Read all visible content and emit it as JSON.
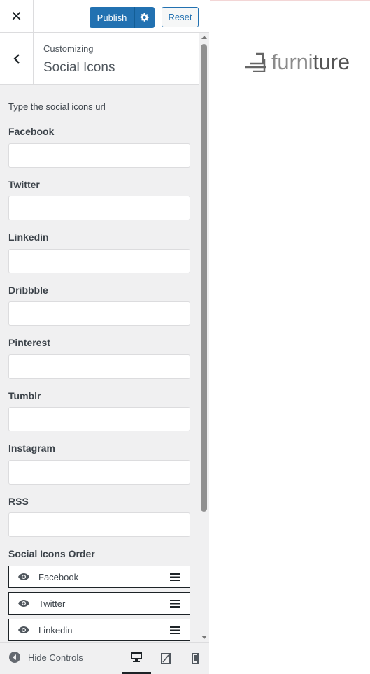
{
  "topbar": {
    "close_glyph": "✕",
    "publish_label": "Publish",
    "reset_label": "Reset"
  },
  "section": {
    "customizing_label": "Customizing",
    "title": "Social Icons"
  },
  "description": "Type the social icons url",
  "fields": [
    {
      "label": "Facebook",
      "value": ""
    },
    {
      "label": "Twitter",
      "value": ""
    },
    {
      "label": "Linkedin",
      "value": ""
    },
    {
      "label": "Dribbble",
      "value": ""
    },
    {
      "label": "Pinterest",
      "value": ""
    },
    {
      "label": "Tumblr",
      "value": ""
    },
    {
      "label": "Instagram",
      "value": ""
    },
    {
      "label": "RSS",
      "value": ""
    }
  ],
  "order": {
    "label": "Social Icons Order",
    "items": [
      "Facebook",
      "Twitter",
      "Linkedin"
    ]
  },
  "footer": {
    "hide_controls_label": "Hide Controls",
    "active_device": "desktop"
  },
  "preview": {
    "logo_part1": "furni",
    "logo_part2": "ture"
  },
  "colors": {
    "primary": "#2271b1",
    "sidebar_bg": "#f0f0f1"
  },
  "icons": [
    "close-icon",
    "gear-icon",
    "chevron-left-icon",
    "eye-icon",
    "drag-handle-icon",
    "collapse-icon",
    "desktop-icon",
    "tablet-icon",
    "mobile-icon"
  ]
}
